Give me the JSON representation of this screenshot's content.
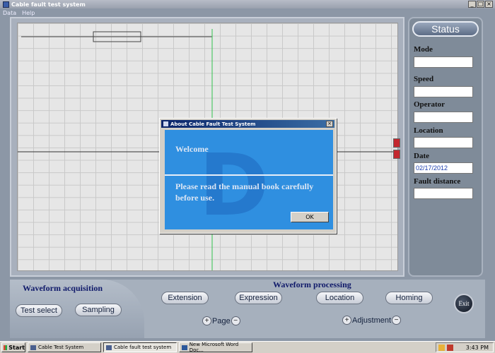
{
  "window": {
    "title": "Cable fault test system",
    "controls": [
      "_",
      "□",
      "×"
    ]
  },
  "menu": {
    "items": [
      "Data",
      "Help"
    ]
  },
  "status": {
    "button_label": "Status",
    "fields": [
      {
        "label": "Mode",
        "value": ""
      },
      {
        "label": "Speed",
        "value": ""
      },
      {
        "label": "Operator",
        "value": ""
      },
      {
        "label": "Location",
        "value": ""
      },
      {
        "label": "Date",
        "value": "02/17/2012"
      },
      {
        "label": "Fault distance",
        "value": ""
      }
    ]
  },
  "acquisition": {
    "title": "Waveform acquisition",
    "test_select": "Test select",
    "sampling": "Sampling"
  },
  "processing": {
    "title": "Waveform processing",
    "extension": "Extension",
    "expression": "Expression",
    "location": "Location",
    "homing": "Homing",
    "page_label": "Page",
    "adjustment_label": "Adjustment",
    "plus": "+",
    "minus": "−"
  },
  "exit_label": "Exit",
  "dialog": {
    "title": "About Cable Fault Test System",
    "close": "×",
    "welcome": "Welcome",
    "message": "Please read the manual book carefully before use.",
    "ok": "OK",
    "watermark": "D"
  },
  "taskbar": {
    "start": "Start",
    "tasks": [
      "Cable Test System",
      "Cable fault test system",
      "New Microsoft Word Doc..."
    ],
    "clock": "3:43 PM"
  },
  "colors": {
    "accent": "#2f8fe0",
    "titlebar": "#0a246a",
    "marker": "#c3272e",
    "cursor_line": "#33c24d"
  }
}
